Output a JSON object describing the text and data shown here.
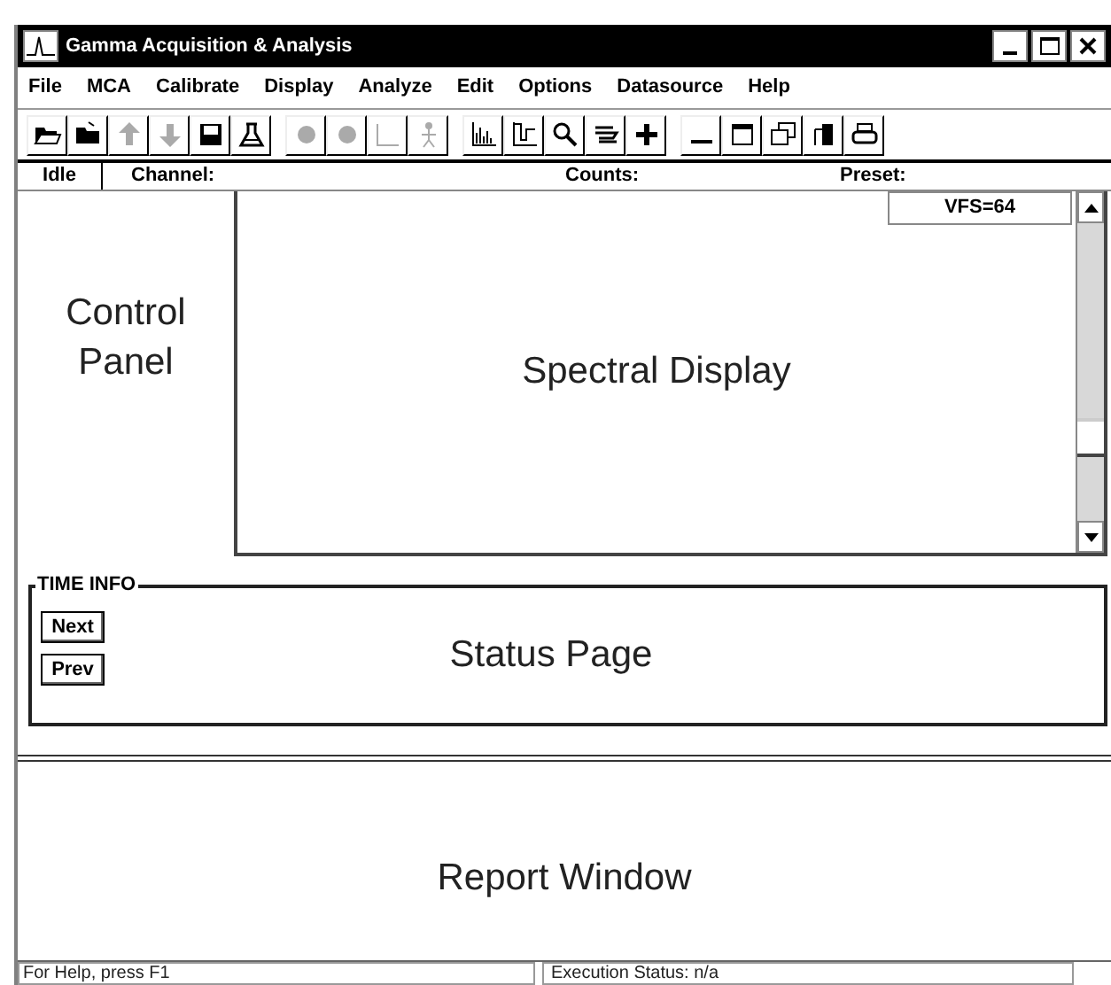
{
  "window": {
    "title": "Gamma Acquisition & Analysis"
  },
  "menu": [
    "File",
    "MCA",
    "Calibrate",
    "Display",
    "Analyze",
    "Edit",
    "Options",
    "Datasource",
    "Help"
  ],
  "toolbar": [
    [
      {
        "kind": "open",
        "disabled": false
      },
      {
        "kind": "folder",
        "disabled": false
      },
      {
        "kind": "up",
        "disabled": true
      },
      {
        "kind": "down",
        "disabled": true
      },
      {
        "kind": "save",
        "disabled": false
      },
      {
        "kind": "flask",
        "disabled": false
      }
    ],
    [
      {
        "kind": "blob",
        "disabled": true
      },
      {
        "kind": "blob",
        "disabled": true
      },
      {
        "kind": "line",
        "disabled": true
      },
      {
        "kind": "figure",
        "disabled": true
      }
    ],
    [
      {
        "kind": "bars",
        "disabled": false
      },
      {
        "kind": "bars2",
        "disabled": false
      },
      {
        "kind": "zoom",
        "disabled": false
      },
      {
        "kind": "stack",
        "disabled": false
      },
      {
        "kind": "plus",
        "disabled": false
      }
    ],
    [
      {
        "kind": "min",
        "disabled": false
      },
      {
        "kind": "win",
        "disabled": false
      },
      {
        "kind": "wins",
        "disabled": false
      },
      {
        "kind": "door",
        "disabled": false
      },
      {
        "kind": "print",
        "disabled": false
      }
    ]
  ],
  "status_row": {
    "state": "Idle",
    "channel": "Channel:",
    "counts": "Counts:",
    "preset": "Preset:"
  },
  "control_panel": "Control Panel",
  "spectral_display": {
    "label": "Spectral Display",
    "vfs": "VFS=64"
  },
  "time_info": {
    "title": "TIME INFO",
    "buttons": [
      "Next",
      "Prev"
    ],
    "label": "Status Page"
  },
  "report_window": "Report Window",
  "status_bar": [
    "For Help, press F1",
    "Execution Status:  n/a"
  ]
}
